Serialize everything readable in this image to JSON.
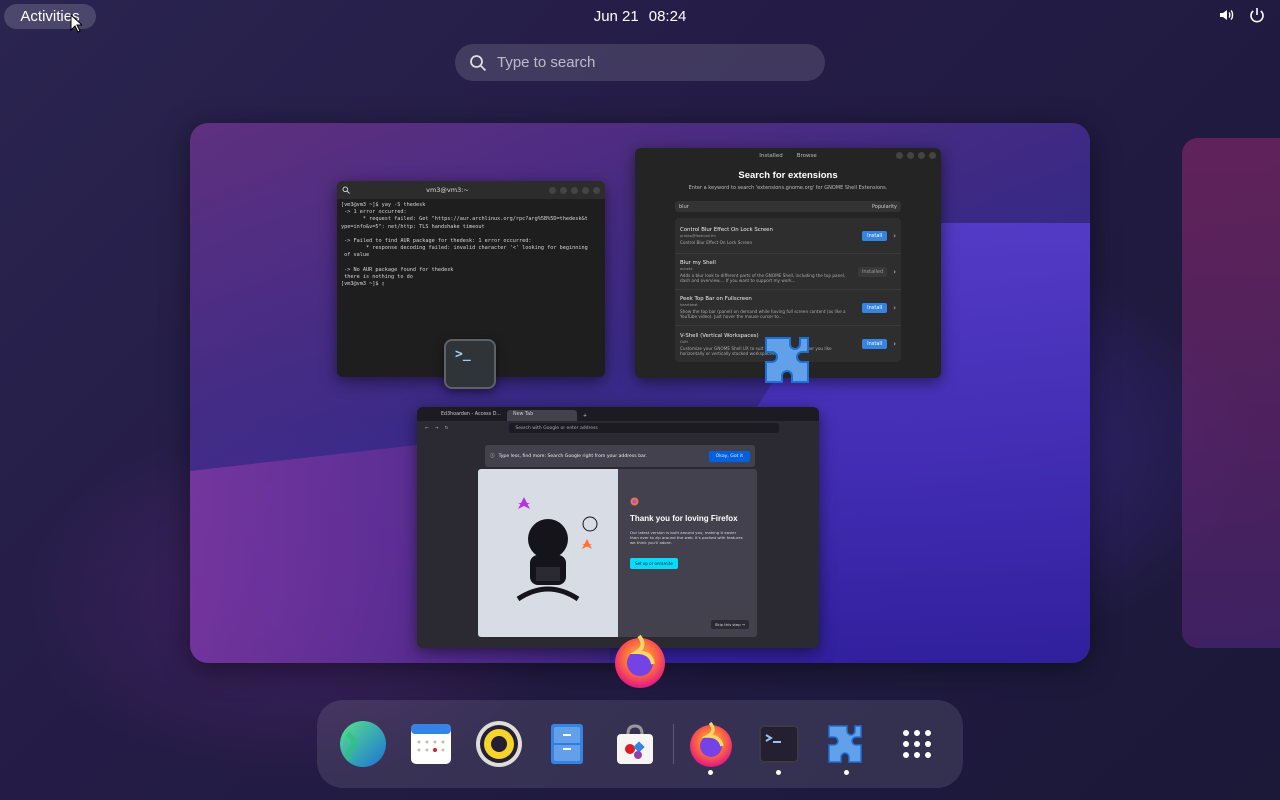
{
  "topbar": {
    "activities_label": "Activities",
    "date": "Jun 21",
    "time": "08:24"
  },
  "search": {
    "placeholder": "Type to search"
  },
  "terminal": {
    "title": "vm3@vm3:~",
    "lines": "[vm3@vm3 ~]$ yay -S thedesk\n -> 1 error occurred:\n       * request failed: Get \"https://aur.archlinux.org/rpc?arg%5B%5D=thedesk&t\nype=info&v=5\": net/http: TLS handshake timeout\n\n -> Failed to find AUR package for thedesk: 1 error occurred:\n        * response decoding failed: invalid character '<' looking for beginning\n of value\n\n -> No AUR package found for thedesk\n there is nothing to do\n[vm3@vm3 ~]$ ▯"
  },
  "extensions": {
    "tab_installed": "Installed",
    "tab_browse": "Browse",
    "heading": "Search for extensions",
    "subheading": "Enter a keyword to search 'extensions.gnome.org' for GNOME Shell Extensions.",
    "search_value": "blur",
    "sort_label": "Popularity",
    "items": [
      {
        "name": "Control Blur Effect On Lock Screen",
        "author": "pratap@fastmail.fm",
        "desc": "Control Blur Effect On Lock Screen",
        "action": "Install"
      },
      {
        "name": "Blur my Shell",
        "author": "aunetx",
        "desc": "Adds a blur look to different parts of the GNOME Shell, including the top panel, dash and overview.... If you want to support my work...",
        "action": "Installed"
      },
      {
        "name": "Peek Top Bar on Fullscreen",
        "author": "heartbeat",
        "desc": "Show the top bar (panel) on demand while having full screen content (as like a YouTube video). Just hover the mouse cursor to...",
        "action": "Install"
      },
      {
        "name": "V-Shell (Vertical Workspaces)",
        "author": "GdH",
        "desc": "Customize your GNOME Shell UX to suit your workflow, whether you like horizontally or vertically stacked workspaces... View su...",
        "action": "Install"
      }
    ]
  },
  "firefox": {
    "tab1": "Ed3hoarden - Access D...",
    "tab2": "New Tab",
    "url_placeholder": "Search with Google or enter address",
    "notice": "Type less, find more: Search Google right from your address bar.",
    "notice_button": "Okay, Got it",
    "card_title": "Thank you for loving Firefox",
    "card_body": "Our latest version is built around you, making it easier than ever to zip around the web. It's packed with features we think you'll adore.",
    "card_cta": "Set up or onramite",
    "card_skip": "Skip this step →"
  },
  "dash": {
    "apps": [
      "web-browser",
      "calendar",
      "rhythmbox",
      "files",
      "software",
      "firefox",
      "terminal",
      "extensions",
      "show-apps"
    ]
  },
  "colors": {
    "accent": "#3584e4",
    "firefox_cta": "#00ddff",
    "background": "#1d1838"
  }
}
